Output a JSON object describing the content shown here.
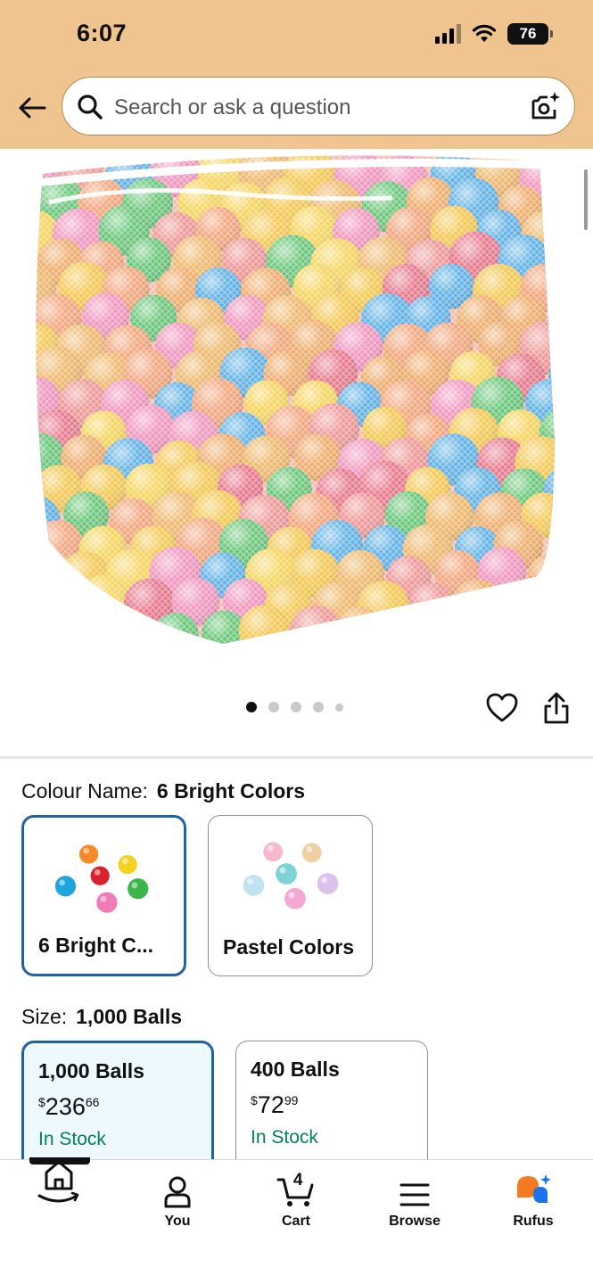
{
  "status_bar": {
    "time": "6:07",
    "battery": "76"
  },
  "search": {
    "placeholder": "Search or ask a question"
  },
  "product": {
    "image_alt": "Mesh bag filled with colorful plastic play balls",
    "image_pager": {
      "count": 5,
      "active_index": 0
    }
  },
  "colour": {
    "label": "Colour Name:",
    "selected_value": "6 Bright Colors",
    "options": [
      {
        "name": "6 Bright C...",
        "selected": true
      },
      {
        "name": "Pastel Colors",
        "selected": false
      }
    ]
  },
  "size": {
    "label": "Size:",
    "selected_value": "1,000 Balls",
    "options": [
      {
        "title": "1,000 Balls",
        "currency": "$",
        "price_whole": "236",
        "price_fraction": "66",
        "stock": "In Stock",
        "selected": true
      },
      {
        "title": "400 Balls",
        "currency": "$",
        "price_whole": "72",
        "price_fraction": "99",
        "stock": "In Stock",
        "selected": false
      }
    ]
  },
  "bottom_nav": {
    "items": [
      {
        "label": "",
        "icon": "home-icon"
      },
      {
        "label": "You",
        "icon": "person-icon"
      },
      {
        "label": "Cart",
        "icon": "cart-icon",
        "badge": "4"
      },
      {
        "label": "Browse",
        "icon": "menu-icon"
      },
      {
        "label": "Rufus",
        "icon": "rufus-icon"
      }
    ]
  },
  "colors": {
    "header_bg": "#f0c48f",
    "selected_border": "#2162a1",
    "in_stock": "#067d62",
    "rufus_orange": "#f47a20",
    "rufus_blue": "#1a73e8"
  }
}
